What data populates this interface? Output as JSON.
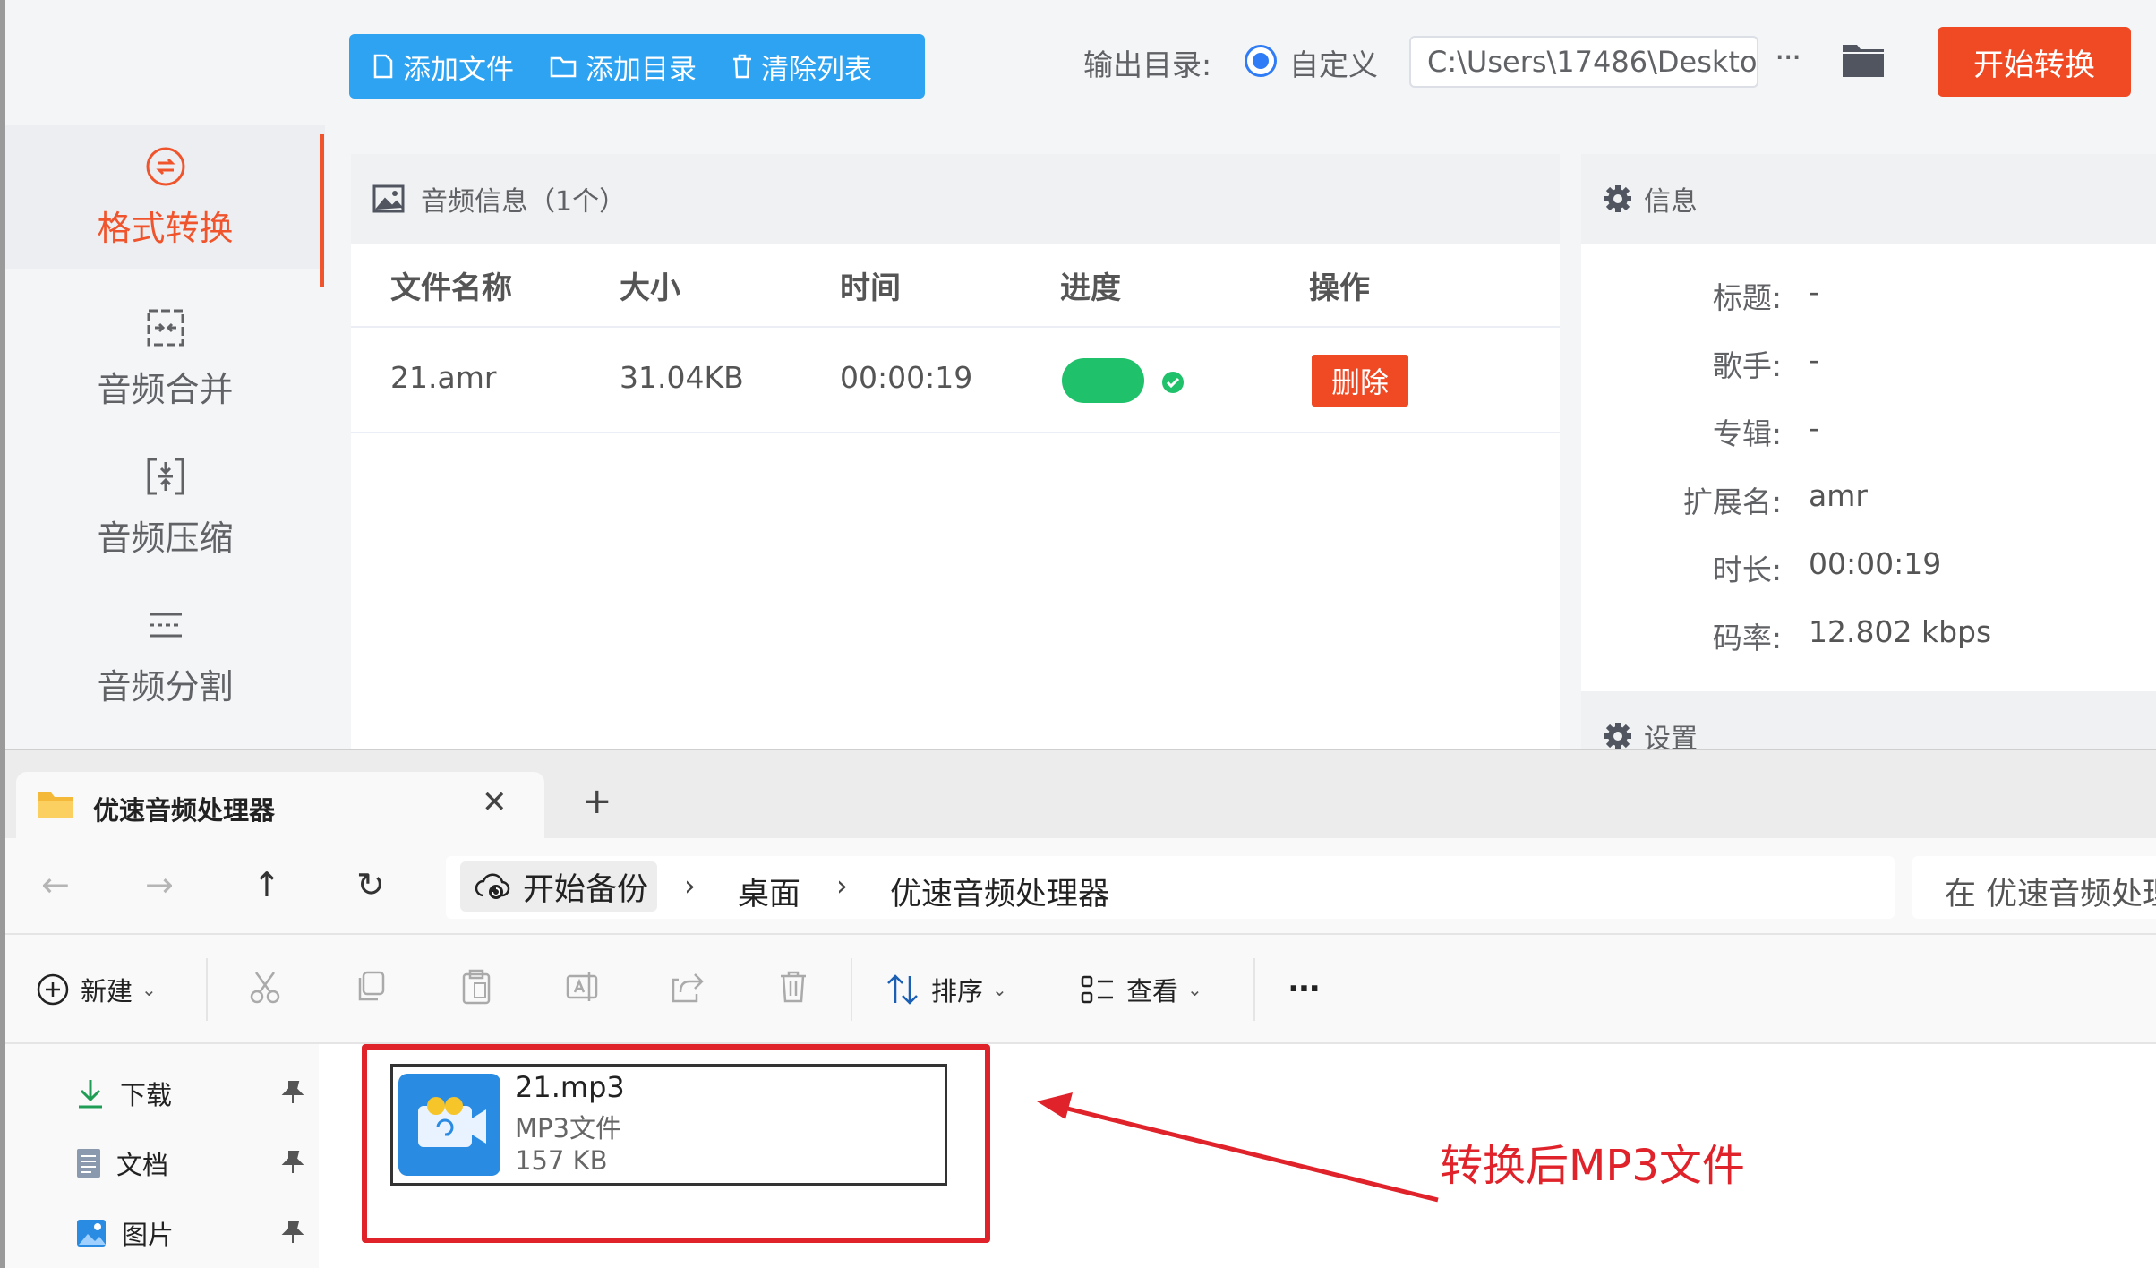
{
  "app": {
    "toolbar": {
      "add_file": "添加文件",
      "add_dir": "添加目录",
      "clear_list": "清除列表"
    },
    "output": {
      "label": "输出目录:",
      "radio_label": "自定义",
      "path": "C:\\Users\\17486\\Deskto",
      "more": "···",
      "start_button": "开始转换"
    },
    "sidebar": {
      "items": [
        {
          "label": "格式转换",
          "icon": "convert-icon",
          "active": true
        },
        {
          "label": "音频合并",
          "icon": "merge-icon"
        },
        {
          "label": "音频压缩",
          "icon": "compress-icon"
        },
        {
          "label": "音频分割",
          "icon": "split-icon"
        }
      ]
    },
    "list": {
      "title": "音频信息（1个）",
      "columns": [
        "文件名称",
        "大小",
        "时间",
        "进度",
        "操作"
      ],
      "rows": [
        {
          "name": "21.amr",
          "size": "31.04KB",
          "time": "00:00:19",
          "progress": 1.0,
          "action": "删除"
        }
      ]
    },
    "info": {
      "title": "信息",
      "fields": [
        {
          "key": "标题:",
          "value": "-"
        },
        {
          "key": "歌手:",
          "value": "-"
        },
        {
          "key": "专辑:",
          "value": "-"
        },
        {
          "key": "扩展名:",
          "value": "amr"
        },
        {
          "key": "时长:",
          "value": "00:00:19"
        },
        {
          "key": "码率:",
          "value": "12.802 kbps"
        }
      ],
      "settings_title": "设置"
    },
    "colors": {
      "accent": "#f04a25",
      "primary": "#2ea3f2",
      "success": "#1fc16b"
    }
  },
  "explorer": {
    "tab": {
      "title": "优速音频处理器",
      "close": "✕",
      "new": "+"
    },
    "nav": {
      "back": "←",
      "forward": "→",
      "up": "↑",
      "refresh": "↻"
    },
    "breadcrumb": [
      "开始备份",
      "桌面",
      "优速音频处理器"
    ],
    "crumb_sep": "›",
    "search_placeholder": "在 优速音频处理器",
    "commands": {
      "new": "新建",
      "sort": "排序",
      "view": "查看",
      "more": "···"
    },
    "navpane": [
      {
        "label": "下载",
        "icon": "download-icon"
      },
      {
        "label": "文档",
        "icon": "document-icon"
      },
      {
        "label": "图片",
        "icon": "picture-icon"
      }
    ],
    "file": {
      "name": "21.mp3",
      "type": "MP3文件",
      "size": "157 KB"
    },
    "annotation": "转换后MP3文件"
  }
}
